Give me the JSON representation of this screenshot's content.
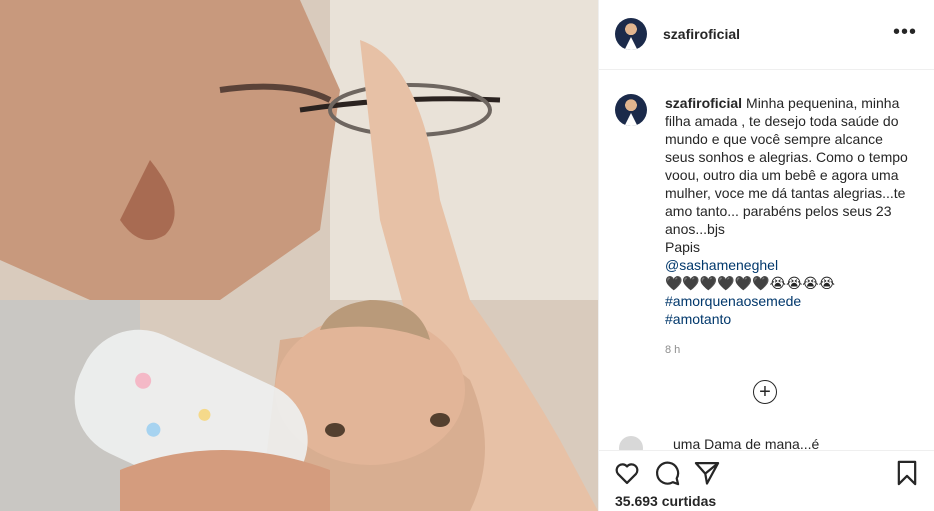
{
  "post": {
    "username": "szafiroficial",
    "more_icon": "•••",
    "caption": {
      "username": "szafiroficial",
      "lines": [
        "Minha pequenina, minha",
        "filha amada , te desejo toda saúde do",
        "mundo e que você sempre alcance",
        "seus sonhos e alegrias. Como o tempo",
        "voou, outro dia um bebê e agora uma",
        "mulher, voce me dá tantas alegrias...te",
        "amo tanto... parabéns pelos seus 23",
        "anos...bjs",
        "Papis"
      ],
      "mention": "@sashameneghel",
      "emojis": "🖤🖤🖤🖤🖤🖤😭😭😭😭",
      "hashtags": [
        "#amorquenaosemede",
        "#amotanto"
      ]
    },
    "time": "8 h",
    "load_more_symbol": "+",
    "peek_comment": "uma Dama de mana...é",
    "likes": "35.693 curtidas"
  },
  "colors": {
    "text": "#262626",
    "link": "#00376b",
    "muted": "#8e8e8e",
    "border": "#efefef"
  }
}
